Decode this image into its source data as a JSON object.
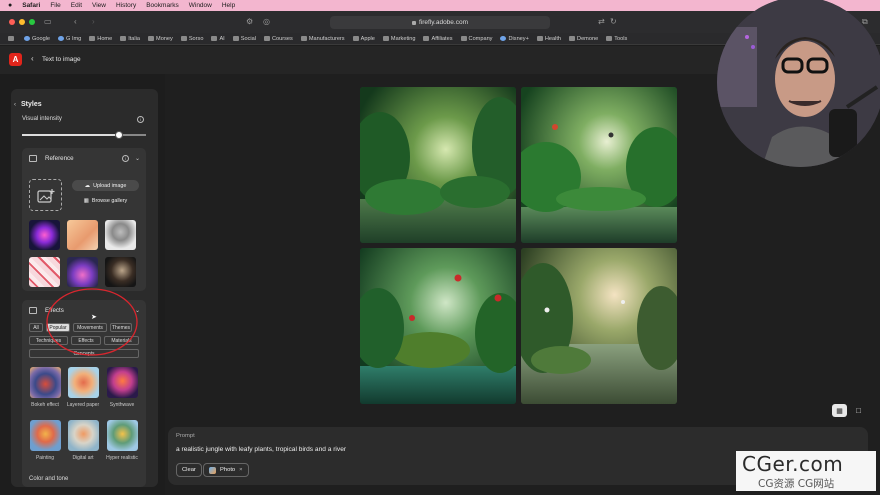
{
  "menubar": {
    "items": [
      "Safari",
      "File",
      "Edit",
      "View",
      "History",
      "Bookmarks",
      "Window",
      "Help"
    ]
  },
  "browser": {
    "url": "firefly.adobe.com"
  },
  "bookmarks": [
    "Google",
    "G Img",
    "Home",
    "Italia",
    "Money",
    "Sorso",
    "AI",
    "Social",
    "Courses",
    "Manufacturers",
    "Apple",
    "Marketing",
    "Affiliates",
    "Company",
    "Disney+",
    "Health",
    "Demone",
    "Tools"
  ],
  "appbar": {
    "back_label": "Text to image"
  },
  "sidebar": {
    "styles_title": "Styles",
    "visual_intensity_label": "Visual intensity",
    "visual_intensity_value": 0.78,
    "reference": {
      "title": "Reference",
      "upload_label": "Upload image",
      "browse_label": "Browse gallery"
    },
    "effects": {
      "title": "Effects",
      "tabs_row1": [
        "All",
        "Popular",
        "Movements",
        "Themes"
      ],
      "tabs_row2": [
        "Techniques",
        "Effects",
        "Materials"
      ],
      "tabs_row3": [
        "Concepts"
      ],
      "selected_tab": "Popular",
      "items": [
        "Bokeh effect",
        "Layered paper",
        "Synthwave",
        "Painting",
        "Digital art",
        "Hyper realistic"
      ]
    },
    "color_tone_label": "Color and tone"
  },
  "prompt": {
    "label": "Prompt",
    "text": "a realistic jungle with leafy plants, tropical birds and a river",
    "clear_label": "Clear",
    "chip_label": "Photo"
  },
  "watermark": {
    "line1": "CGer.com",
    "line2": "CG资源 CG网站"
  },
  "colors": {
    "accent_red": "#e1251b",
    "menubar_pink": "#f3b6cf",
    "annotation_circle": "#d8262e"
  }
}
